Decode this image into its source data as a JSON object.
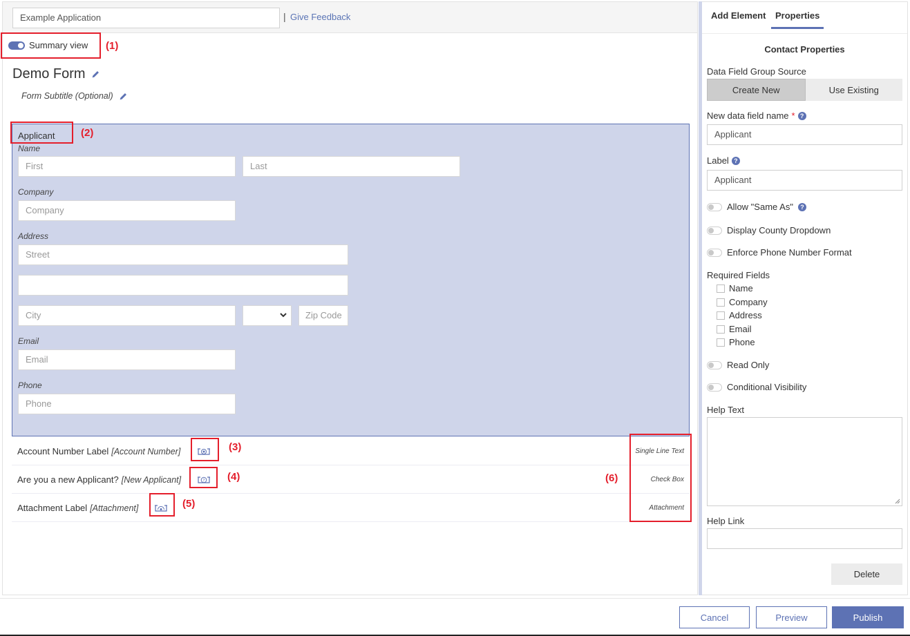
{
  "header": {
    "app_name": "Example Application",
    "separator": "|",
    "feedback_link": "Give Feedback"
  },
  "summary_view": {
    "label": "Summary view",
    "enabled": true
  },
  "form": {
    "title": "Demo Form",
    "subtitle": "Form Subtitle (Optional)"
  },
  "contact": {
    "title": "Applicant",
    "name_label": "Name",
    "first_placeholder": "First",
    "last_placeholder": "Last",
    "company_label": "Company",
    "company_placeholder": "Company",
    "address_label": "Address",
    "street_placeholder": "Street",
    "street2_placeholder": "",
    "city_placeholder": "City",
    "state_value": "",
    "zip_placeholder": "Zip Code",
    "email_label": "Email",
    "email_placeholder": "Email",
    "phone_label": "Phone",
    "phone_placeholder": "Phone"
  },
  "fields": [
    {
      "label": "Account Number Label",
      "data_field": "[Account Number]",
      "type": "Single Line Text",
      "icon": "summary-field-icon"
    },
    {
      "label": "Are you a new Applicant?",
      "data_field": "[New Applicant]",
      "type": "Check Box",
      "icon": "question-field-icon"
    },
    {
      "label": "Attachment Label",
      "data_field": "[Attachment]",
      "type": "Attachment",
      "icon": "attachment-field-icon"
    }
  ],
  "annotations": [
    "(1)",
    "(2)",
    "(3)",
    "(4)",
    "(5)",
    "(6)"
  ],
  "panel": {
    "tabs": [
      {
        "label": "Add Element",
        "active": false
      },
      {
        "label": "Properties",
        "active": true
      }
    ],
    "heading": "Contact Properties",
    "source_label": "Data Field Group Source",
    "source_options": [
      {
        "label": "Create New",
        "active": true
      },
      {
        "label": "Use Existing",
        "active": false
      }
    ],
    "field_name_label": "New data field name",
    "required_marker": "*",
    "field_name_value": "Applicant",
    "label_label": "Label",
    "label_value": "Applicant",
    "help_glyph": "?",
    "toggles": [
      {
        "label": "Allow \"Same As\"",
        "on": false,
        "help": true
      },
      {
        "label": "Display County Dropdown",
        "on": false
      },
      {
        "label": "Enforce Phone Number Format",
        "on": false
      }
    ],
    "required_fields_label": "Required Fields",
    "required_fields": [
      {
        "label": "Name",
        "checked": false
      },
      {
        "label": "Company",
        "checked": false
      },
      {
        "label": "Address",
        "checked": false
      },
      {
        "label": "Email",
        "checked": false
      },
      {
        "label": "Phone",
        "checked": false
      }
    ],
    "toggles2": [
      {
        "label": "Read Only",
        "on": false
      },
      {
        "label": "Conditional Visibility",
        "on": false
      }
    ],
    "help_text_label": "Help Text",
    "help_text_value": "",
    "help_link_label": "Help Link",
    "help_link_value": "",
    "delete_label": "Delete"
  },
  "footer": {
    "cancel_label": "Cancel",
    "preview_label": "Preview",
    "publish_label": "Publish"
  },
  "colors": {
    "accent": "#5d72b4",
    "selection_bg": "#cfd5ea",
    "annotation": "#e41e2b"
  }
}
